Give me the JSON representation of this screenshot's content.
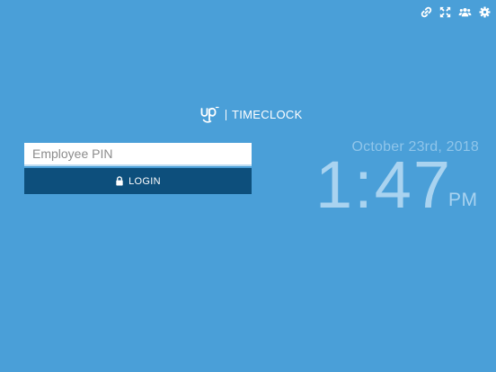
{
  "app": {
    "brand": "UP",
    "name": "TIMECLOCK"
  },
  "toolbar": {
    "icons": [
      "link-icon",
      "fullscreen-icon",
      "group-icon",
      "gear-icon"
    ]
  },
  "login": {
    "pin_placeholder": "Employee PIN",
    "pin_value": "",
    "button_label": "LOGIN"
  },
  "clock": {
    "date": "October 23rd, 2018",
    "time": "1:47",
    "meridiem": "PM"
  },
  "colors": {
    "background": "#4a9fd8",
    "button": "#0d4f7c",
    "clock_text": "#a9d3f0"
  }
}
